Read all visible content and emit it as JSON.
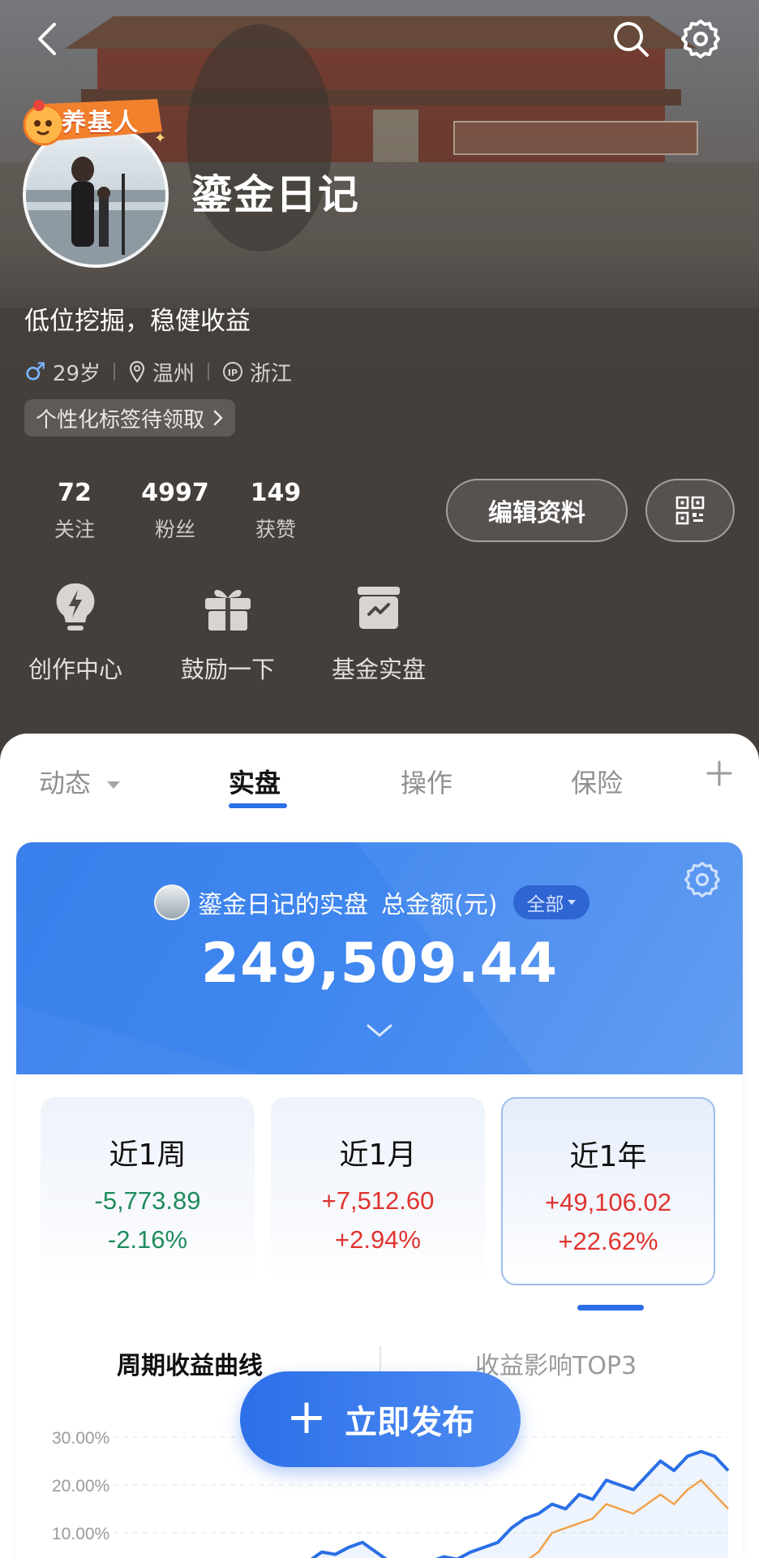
{
  "profile": {
    "badge": "养基人",
    "username": "鎏金日记",
    "bio": "低位挖掘，稳健收益",
    "gender_symbol": "♂",
    "age": "29岁",
    "city": "温州",
    "ip_region": "浙江",
    "tag_prompt": "个性化标签待领取",
    "stats": [
      {
        "value": "72",
        "label": "关注"
      },
      {
        "value": "4997",
        "label": "粉丝"
      },
      {
        "value": "149",
        "label": "获赞"
      }
    ],
    "edit_button": "编辑资料"
  },
  "quick_actions": [
    {
      "label": "创作中心",
      "icon": "lightning-bulb-icon"
    },
    {
      "label": "鼓励一下",
      "icon": "gift-icon"
    },
    {
      "label": "基金实盘",
      "icon": "chart-box-icon"
    }
  ],
  "tabs": [
    {
      "label": "动态",
      "active": false
    },
    {
      "label": "实盘",
      "active": true
    },
    {
      "label": "操作",
      "active": false
    },
    {
      "label": "保险",
      "active": false
    }
  ],
  "portfolio": {
    "title": "鎏金日记的实盘",
    "total_label": "总金额(元)",
    "scope": "全部",
    "total_amount": "249,509.44",
    "periods": [
      {
        "title": "近1周",
        "amount": "-5,773.89",
        "percent": "-2.16%",
        "trend": "neg"
      },
      {
        "title": "近1月",
        "amount": "+7,512.60",
        "percent": "+2.94%",
        "trend": "pos"
      },
      {
        "title": "近1年",
        "amount": "+49,106.02",
        "percent": "+22.62%",
        "trend": "pos"
      }
    ],
    "selected_period": "近1年",
    "chart_tabs": [
      "周期收益曲线",
      "收益影响TOP3"
    ]
  },
  "chart_data": {
    "type": "line",
    "y_ticks": [
      "30.00%",
      "20.00%",
      "10.00%"
    ],
    "ylim": [
      0,
      30
    ],
    "series": [
      {
        "color": "#2a6fe6",
        "values": [
          0,
          1,
          3.5,
          4,
          6,
          5.5,
          7,
          8,
          6,
          4,
          2,
          3,
          4,
          5,
          4.5,
          6,
          7,
          8,
          11,
          13,
          14,
          16,
          15,
          18,
          17,
          21,
          20,
          19,
          22,
          25,
          23,
          26,
          27,
          26,
          23
        ]
      },
      {
        "color": "#f0a24a",
        "values": [
          -2,
          -2,
          -1,
          -1,
          0,
          -1,
          0,
          1,
          0,
          -1,
          -2,
          -2,
          -1,
          0,
          -1,
          0,
          0,
          1,
          2,
          4,
          6,
          10,
          11,
          12,
          13,
          16,
          15,
          14,
          16,
          18,
          16,
          19,
          21,
          18,
          15
        ]
      }
    ]
  },
  "fab": {
    "label": "立即发布"
  },
  "colors": {
    "accent": "#2a6fe6",
    "gain": "#e0342f",
    "loss": "#1f8b5c"
  }
}
